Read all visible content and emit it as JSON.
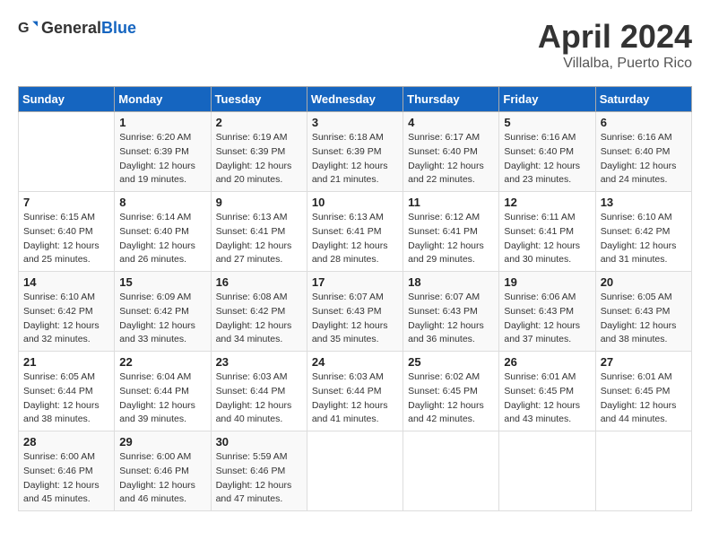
{
  "header": {
    "logo_general": "General",
    "logo_blue": "Blue",
    "month": "April 2024",
    "location": "Villalba, Puerto Rico"
  },
  "weekdays": [
    "Sunday",
    "Monday",
    "Tuesday",
    "Wednesday",
    "Thursday",
    "Friday",
    "Saturday"
  ],
  "weeks": [
    [
      {
        "day": "",
        "info": ""
      },
      {
        "day": "1",
        "info": "Sunrise: 6:20 AM\nSunset: 6:39 PM\nDaylight: 12 hours\nand 19 minutes."
      },
      {
        "day": "2",
        "info": "Sunrise: 6:19 AM\nSunset: 6:39 PM\nDaylight: 12 hours\nand 20 minutes."
      },
      {
        "day": "3",
        "info": "Sunrise: 6:18 AM\nSunset: 6:39 PM\nDaylight: 12 hours\nand 21 minutes."
      },
      {
        "day": "4",
        "info": "Sunrise: 6:17 AM\nSunset: 6:40 PM\nDaylight: 12 hours\nand 22 minutes."
      },
      {
        "day": "5",
        "info": "Sunrise: 6:16 AM\nSunset: 6:40 PM\nDaylight: 12 hours\nand 23 minutes."
      },
      {
        "day": "6",
        "info": "Sunrise: 6:16 AM\nSunset: 6:40 PM\nDaylight: 12 hours\nand 24 minutes."
      }
    ],
    [
      {
        "day": "7",
        "info": "Sunrise: 6:15 AM\nSunset: 6:40 PM\nDaylight: 12 hours\nand 25 minutes."
      },
      {
        "day": "8",
        "info": "Sunrise: 6:14 AM\nSunset: 6:40 PM\nDaylight: 12 hours\nand 26 minutes."
      },
      {
        "day": "9",
        "info": "Sunrise: 6:13 AM\nSunset: 6:41 PM\nDaylight: 12 hours\nand 27 minutes."
      },
      {
        "day": "10",
        "info": "Sunrise: 6:13 AM\nSunset: 6:41 PM\nDaylight: 12 hours\nand 28 minutes."
      },
      {
        "day": "11",
        "info": "Sunrise: 6:12 AM\nSunset: 6:41 PM\nDaylight: 12 hours\nand 29 minutes."
      },
      {
        "day": "12",
        "info": "Sunrise: 6:11 AM\nSunset: 6:41 PM\nDaylight: 12 hours\nand 30 minutes."
      },
      {
        "day": "13",
        "info": "Sunrise: 6:10 AM\nSunset: 6:42 PM\nDaylight: 12 hours\nand 31 minutes."
      }
    ],
    [
      {
        "day": "14",
        "info": "Sunrise: 6:10 AM\nSunset: 6:42 PM\nDaylight: 12 hours\nand 32 minutes."
      },
      {
        "day": "15",
        "info": "Sunrise: 6:09 AM\nSunset: 6:42 PM\nDaylight: 12 hours\nand 33 minutes."
      },
      {
        "day": "16",
        "info": "Sunrise: 6:08 AM\nSunset: 6:42 PM\nDaylight: 12 hours\nand 34 minutes."
      },
      {
        "day": "17",
        "info": "Sunrise: 6:07 AM\nSunset: 6:43 PM\nDaylight: 12 hours\nand 35 minutes."
      },
      {
        "day": "18",
        "info": "Sunrise: 6:07 AM\nSunset: 6:43 PM\nDaylight: 12 hours\nand 36 minutes."
      },
      {
        "day": "19",
        "info": "Sunrise: 6:06 AM\nSunset: 6:43 PM\nDaylight: 12 hours\nand 37 minutes."
      },
      {
        "day": "20",
        "info": "Sunrise: 6:05 AM\nSunset: 6:43 PM\nDaylight: 12 hours\nand 38 minutes."
      }
    ],
    [
      {
        "day": "21",
        "info": "Sunrise: 6:05 AM\nSunset: 6:44 PM\nDaylight: 12 hours\nand 38 minutes."
      },
      {
        "day": "22",
        "info": "Sunrise: 6:04 AM\nSunset: 6:44 PM\nDaylight: 12 hours\nand 39 minutes."
      },
      {
        "day": "23",
        "info": "Sunrise: 6:03 AM\nSunset: 6:44 PM\nDaylight: 12 hours\nand 40 minutes."
      },
      {
        "day": "24",
        "info": "Sunrise: 6:03 AM\nSunset: 6:44 PM\nDaylight: 12 hours\nand 41 minutes."
      },
      {
        "day": "25",
        "info": "Sunrise: 6:02 AM\nSunset: 6:45 PM\nDaylight: 12 hours\nand 42 minutes."
      },
      {
        "day": "26",
        "info": "Sunrise: 6:01 AM\nSunset: 6:45 PM\nDaylight: 12 hours\nand 43 minutes."
      },
      {
        "day": "27",
        "info": "Sunrise: 6:01 AM\nSunset: 6:45 PM\nDaylight: 12 hours\nand 44 minutes."
      }
    ],
    [
      {
        "day": "28",
        "info": "Sunrise: 6:00 AM\nSunset: 6:46 PM\nDaylight: 12 hours\nand 45 minutes."
      },
      {
        "day": "29",
        "info": "Sunrise: 6:00 AM\nSunset: 6:46 PM\nDaylight: 12 hours\nand 46 minutes."
      },
      {
        "day": "30",
        "info": "Sunrise: 5:59 AM\nSunset: 6:46 PM\nDaylight: 12 hours\nand 47 minutes."
      },
      {
        "day": "",
        "info": ""
      },
      {
        "day": "",
        "info": ""
      },
      {
        "day": "",
        "info": ""
      },
      {
        "day": "",
        "info": ""
      }
    ]
  ]
}
